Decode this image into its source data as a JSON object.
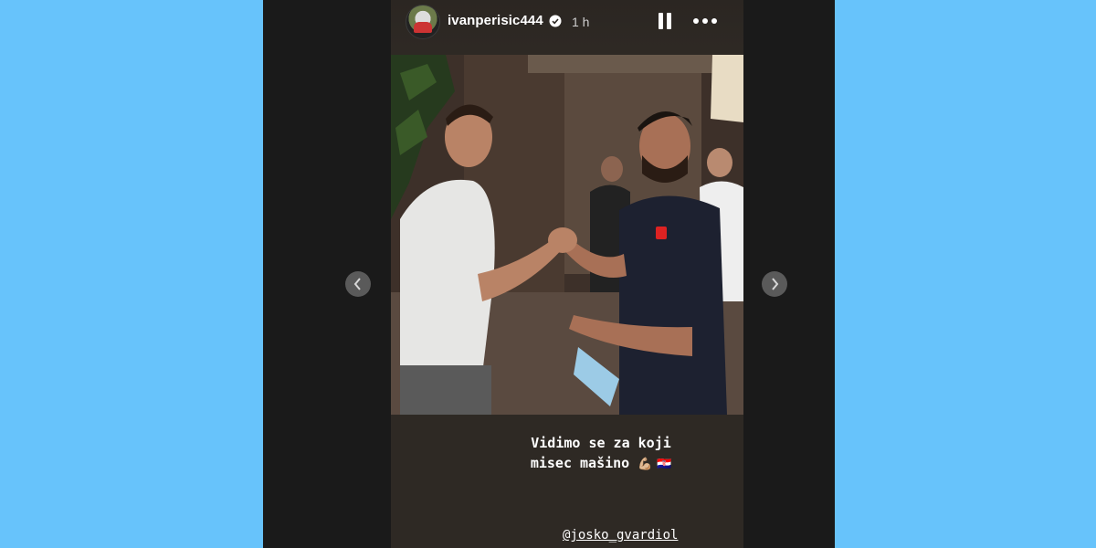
{
  "story": {
    "username": "ivanperisic444",
    "time": "1 h",
    "caption_line1": "Vidimo se za koji",
    "caption_line2": "misec mašino",
    "caption_emoji": "💪🏼 🇭🇷",
    "mention": "@josko_gvardiol"
  },
  "colors": {
    "background": "#67c3fb",
    "viewer": "#1a1a1a",
    "story_bg": "#2e2924",
    "verified": "#ffffff"
  },
  "icons": {
    "header": [
      "verified-icon",
      "pause-icon",
      "more-icon"
    ],
    "navigation": [
      "chevron-left-icon",
      "chevron-right-icon"
    ]
  }
}
